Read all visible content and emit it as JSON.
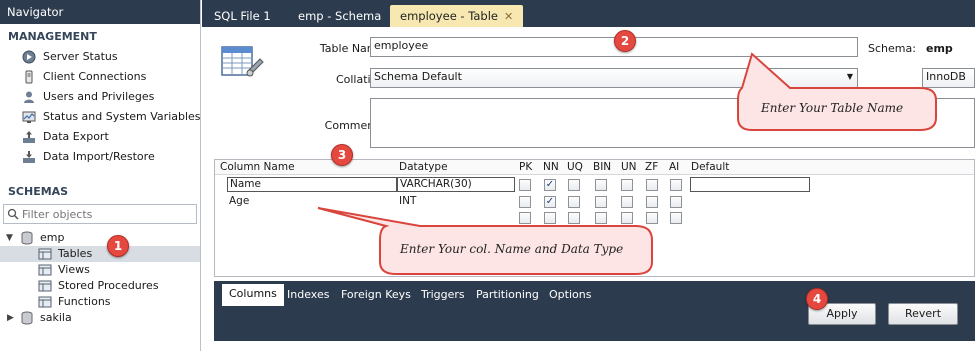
{
  "navigator": {
    "title": "Navigator",
    "management_heading": "MANAGEMENT",
    "management_items": [
      {
        "label": "Server Status",
        "icon": "server-status-icon"
      },
      {
        "label": "Client Connections",
        "icon": "client-connections-icon"
      },
      {
        "label": "Users and Privileges",
        "icon": "users-icon"
      },
      {
        "label": "Status and System Variables",
        "icon": "system-variables-icon"
      },
      {
        "label": "Data Export",
        "icon": "data-export-icon"
      },
      {
        "label": "Data Import/Restore",
        "icon": "data-import-icon"
      }
    ],
    "schemas_heading": "SCHEMAS",
    "filter_placeholder": "Filter objects",
    "tree": {
      "emp": "emp",
      "tables": "Tables",
      "views": "Views",
      "stored_procedures": "Stored Procedures",
      "functions": "Functions",
      "sakila": "sakila"
    }
  },
  "tabs": [
    {
      "label": "SQL File 1"
    },
    {
      "label": "emp - Schema"
    },
    {
      "label": "employee - Table",
      "close": "✕"
    }
  ],
  "editor": {
    "table_name_label": "Table Name:",
    "table_name_value": "employee",
    "schema_label": "Schema:",
    "schema_value": "emp",
    "collation_label": "Collation:",
    "collation_value": "Schema Default",
    "engine_value": "InnoDB",
    "comments_label": "Comments:"
  },
  "columns_grid": {
    "headers": [
      "Column Name",
      "Datatype",
      "PK",
      "NN",
      "UQ",
      "BIN",
      "UN",
      "ZF",
      "AI",
      "Default"
    ],
    "rows": [
      {
        "name": "Name",
        "datatype": "VARCHAR(30)",
        "nn": true
      },
      {
        "name": "Age",
        "datatype": "INT",
        "nn": true
      },
      {
        "name": "",
        "datatype": "",
        "nn": false
      }
    ]
  },
  "bottom_tabs": [
    "Columns",
    "Indexes",
    "Foreign Keys",
    "Triggers",
    "Partitioning",
    "Options"
  ],
  "buttons": {
    "apply": "Apply",
    "revert": "Revert"
  },
  "annotations": {
    "badge_1": "1",
    "badge_2": "2",
    "badge_3": "3",
    "badge_4": "4",
    "callout_table_name": "Enter Your Table Name",
    "callout_columns": "Enter Your col. Name  and Data Type"
  },
  "colors": {
    "dark_header": "#2c3b4e",
    "active_tab": "#f7e8b2",
    "badge_red": "#e5483f",
    "callout_fill": "#fce5e4",
    "callout_stroke": "#d9453c"
  }
}
